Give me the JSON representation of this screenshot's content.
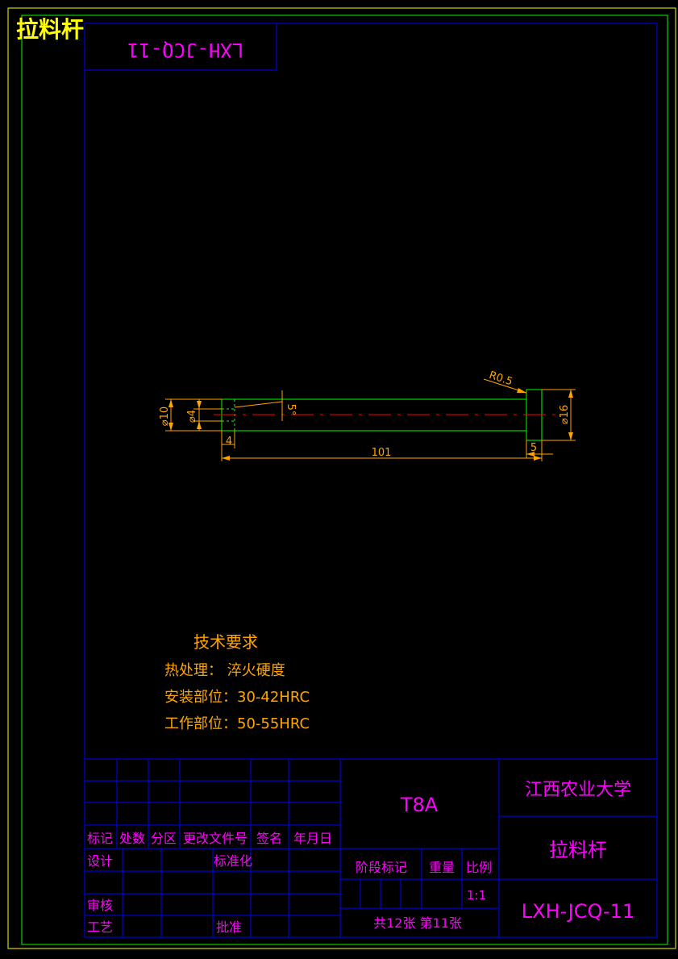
{
  "colors": {
    "border_outer": "#ffff00",
    "border_inner": "#00ff00",
    "frame": "#0000ff",
    "part": "#00ff00",
    "centerline": "#ff0000",
    "dimension": "#ffa500",
    "title_text": "#ff00ff",
    "header": "#ffff00"
  },
  "header": {
    "part_name": "拉料杆",
    "mirrored_code": "LXH-JCQ-11"
  },
  "dimensions": {
    "d10": "⌀10",
    "d4": "⌀4",
    "angle": "5°",
    "len4": "4",
    "len101": "101",
    "len5": "5",
    "d16": "⌀16",
    "r05": "R0.5"
  },
  "tech_req": {
    "title": "技术要求",
    "line1": "热处理：  淬火硬度",
    "line2": "安装部位：30-42HRC",
    "line3": "工作部位：50-55HRC"
  },
  "title_block": {
    "rev_headers": [
      "标记",
      "处数",
      "分区",
      "更改文件号",
      "签名",
      "年月日"
    ],
    "design": "设计",
    "standardize": "标准化",
    "review": "审核",
    "process": "工艺",
    "approve": "批准",
    "material": "T8A",
    "stage_mark": "阶段标记",
    "weight": "重量",
    "scale_label": "比例",
    "scale": "1:1",
    "sheets": "共12张  第11张",
    "org": "江西农业大学",
    "part_name": "拉料杆",
    "drawing_no": "LXH-JCQ-11"
  }
}
